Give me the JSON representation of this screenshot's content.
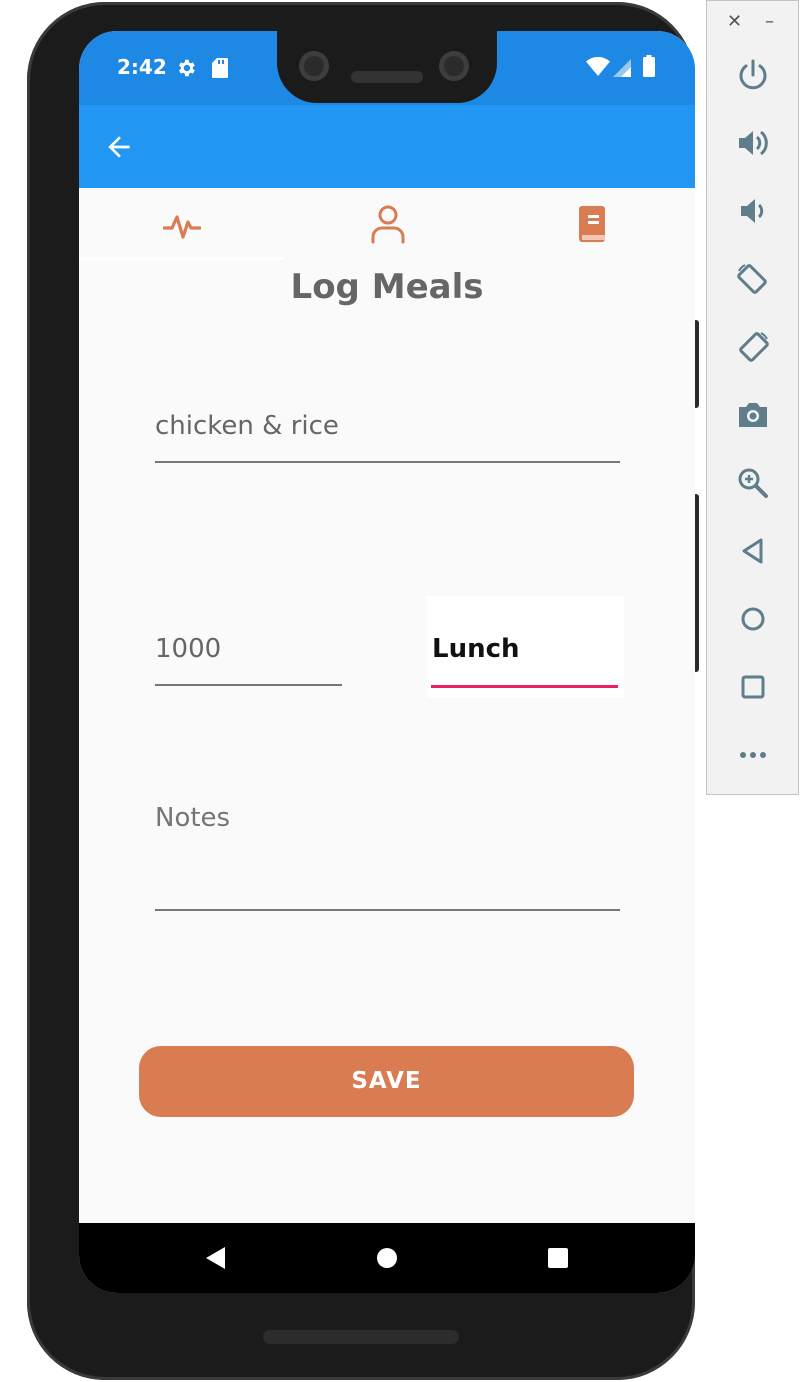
{
  "status_bar": {
    "time": "2:42",
    "left_icons": [
      "gear-icon",
      "sd-card-icon"
    ],
    "right_icons": [
      "wifi-icon",
      "cellular-signal-icon",
      "battery-icon"
    ]
  },
  "app_bar": {
    "back_icon": "arrow-back-icon",
    "color": "#2196f3"
  },
  "tabs": [
    {
      "icon": "activity-icon",
      "selected": true
    },
    {
      "icon": "person-icon",
      "selected": false
    },
    {
      "icon": "book-icon",
      "selected": false
    }
  ],
  "page": {
    "title": "Log Meals"
  },
  "form": {
    "meal_name_value": "chicken & rice",
    "calories_value": "1000",
    "meal_type_selected": "Lunch",
    "notes_placeholder": "Notes",
    "notes_value": "",
    "save_label": "SAVE"
  },
  "colors": {
    "accent": "#d97c52",
    "dropdown_underline": "#e91e63",
    "status_bar": "#1e88e5"
  },
  "nav_bar": {
    "icons": [
      "back-triangle-icon",
      "home-circle-icon",
      "overview-square-icon"
    ]
  },
  "emulator_panel": {
    "top_controls": [
      "close-icon",
      "minimize-icon"
    ],
    "buttons": [
      "power-icon",
      "volume-up-icon",
      "volume-down-icon",
      "rotate-left-icon",
      "rotate-right-icon",
      "screenshot-icon",
      "zoom-icon",
      "back-icon",
      "home-icon",
      "overview-icon",
      "more-icon"
    ]
  }
}
